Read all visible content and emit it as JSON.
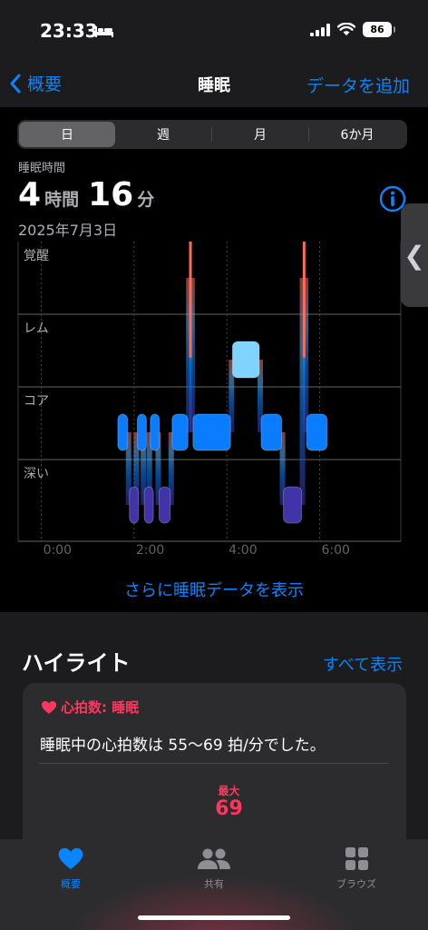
{
  "status": {
    "time": "23:33",
    "battery": "86"
  },
  "nav": {
    "back_label": "概要",
    "title": "睡眠",
    "add_label": "データを追加"
  },
  "segments": [
    "日",
    "週",
    "月",
    "6か月"
  ],
  "summary": {
    "label": "睡眠時間",
    "hours": "4",
    "hours_unit": "時間",
    "minutes": "16",
    "minutes_unit": "分",
    "date": "2025年7月3日"
  },
  "chart_data": {
    "type": "bar",
    "stages": [
      "覚醒",
      "レム",
      "コア",
      "深い"
    ],
    "xticks": [
      "0:00",
      "2:00",
      "4:00",
      "6:00"
    ],
    "xlim": [
      -0.5,
      7.75
    ],
    "segments": [
      {
        "stage": "コア",
        "start": 1.63,
        "end": 1.88
      },
      {
        "stage": "深い",
        "start": 1.88,
        "end": 2.05
      },
      {
        "stage": "コア",
        "start": 2.05,
        "end": 2.2
      },
      {
        "stage": "深い",
        "start": 2.2,
        "end": 2.33
      },
      {
        "stage": "コア",
        "start": 2.33,
        "end": 2.52
      },
      {
        "stage": "深い",
        "start": 2.52,
        "end": 2.8
      },
      {
        "stage": "コア",
        "start": 2.8,
        "end": 3.18
      },
      {
        "stage": "覚醒",
        "start": 3.18,
        "end": 3.25
      },
      {
        "stage": "コア",
        "start": 3.25,
        "end": 4.1
      },
      {
        "stage": "レム",
        "start": 4.1,
        "end": 4.72
      },
      {
        "stage": "コア",
        "start": 4.72,
        "end": 5.2
      },
      {
        "stage": "深い",
        "start": 5.2,
        "end": 5.63
      },
      {
        "stage": "覚醒",
        "start": 5.63,
        "end": 5.7
      },
      {
        "stage": "コア",
        "start": 5.7,
        "end": 6.18
      }
    ],
    "colors": {
      "awake": "#ff6b5a",
      "rem": "#7fd4ff",
      "core": "#0a7dff",
      "deep": "#4133a8"
    }
  },
  "show_more": "さらに睡眠データを表示",
  "highlights": {
    "title": "ハイライト",
    "show_all": "すべて表示",
    "card": {
      "category": "心拍数: 睡眠",
      "text": "睡眠中の心拍数は 55〜69 拍/分でした。",
      "max_label": "最大",
      "max_value": "69"
    }
  },
  "tabs": [
    "概要",
    "共有",
    "ブラウズ"
  ]
}
